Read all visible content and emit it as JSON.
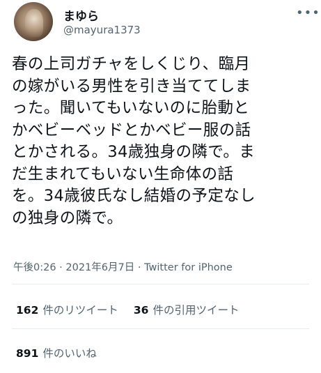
{
  "user": {
    "display_name": "まゆら",
    "handle": "@mayura1373"
  },
  "more_icon": "more-dots-icon",
  "tweet": {
    "lines": [
      "春の上司ガチャをしくじり、臨月",
      "の嫁がいる男性を引き当ててしま",
      "った。聞いてもいないのに胎動と",
      "かベビーベッドとかベビー服の話",
      "とかされる。34歳独身の隣で。ま",
      "だ生まれてもいない生命体の話",
      "を。34歳彼氏なし結婚の予定なし",
      "の独身の隣で。"
    ]
  },
  "meta": {
    "time": "午後0:26",
    "separator1": " · ",
    "date": "2021年6月7日",
    "separator2": " · ",
    "source": "Twitter for iPhone"
  },
  "stats": {
    "retweets_count": "162",
    "retweets_label": "件のリツイート",
    "quotes_count": "36",
    "quotes_label": "件の引用ツイート",
    "likes_count": "891",
    "likes_label": "件のいいね"
  },
  "colors": {
    "text": "#0f1419",
    "secondary": "#536471",
    "divider": "#e6ecf0"
  }
}
